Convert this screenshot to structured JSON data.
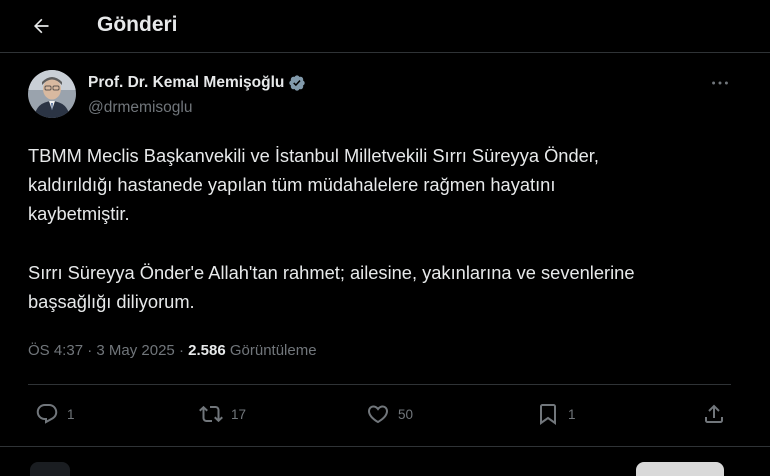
{
  "header": {
    "title": "Gönderi"
  },
  "post": {
    "author_name": "Prof. Dr. Kemal Memişoğlu",
    "handle": "@drmemisoglu",
    "paragraph1": "TBMM Meclis Başkanvekili ve İstanbul Milletvekili Sırrı Süreyya Önder,\nkaldırıldığı hastanede yapılan tüm müdahalelere rağmen hayatını\nkaybetmiştir.",
    "paragraph2": "Sırrı Süreyya Önder'e Allah'tan rahmet; ailesine, yakınlarına ve sevenlerine\nbaşsağlığı diliyorum.",
    "time": "ÖS 4:37",
    "date": "3 May 2025",
    "separator": "·",
    "views_count": "2.586",
    "views_label": "Görüntüleme"
  },
  "actions": {
    "replies": "1",
    "reposts": "17",
    "likes": "50",
    "bookmarks": "1"
  },
  "icons": {
    "back": "arrow-left-icon",
    "verified": "verified-badge-icon",
    "more": "more-dots-icon",
    "reply": "comment-icon",
    "repost": "repost-icon",
    "like": "heart-icon",
    "bookmark": "bookmark-icon",
    "share": "share-icon"
  },
  "colors": {
    "background": "#000000",
    "text": "#e7e9ea",
    "muted": "#71767b",
    "divider": "#2f3336"
  }
}
